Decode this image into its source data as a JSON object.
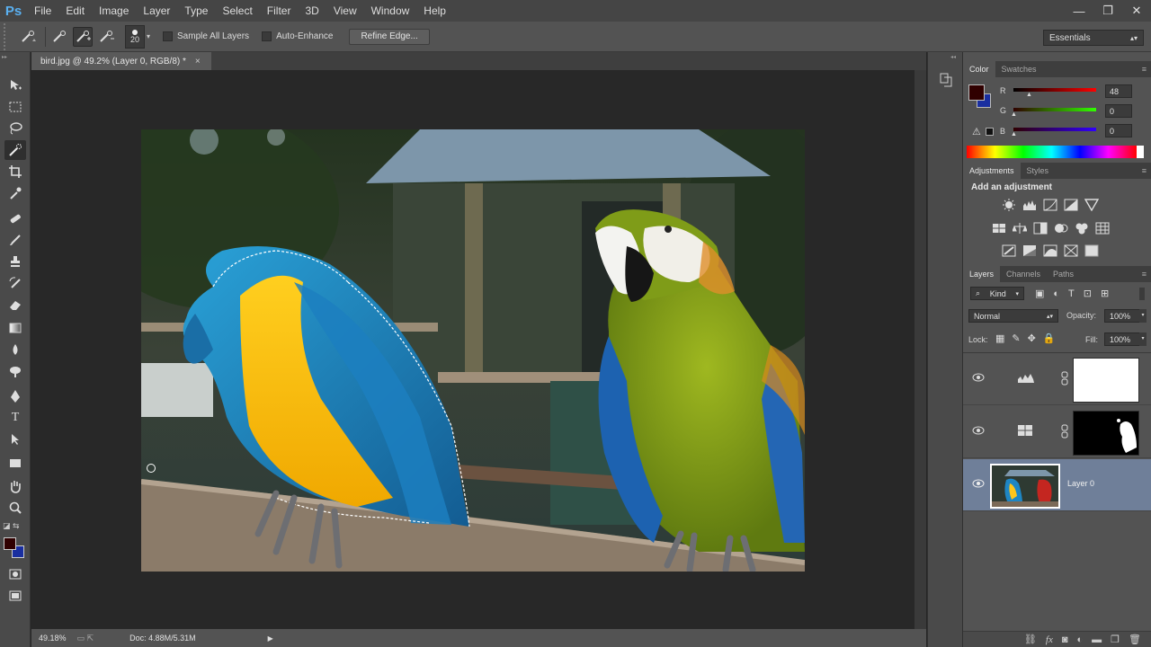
{
  "app": {
    "logo": "Ps"
  },
  "menu": [
    "File",
    "Edit",
    "Image",
    "Layer",
    "Type",
    "Select",
    "Filter",
    "3D",
    "View",
    "Window",
    "Help"
  ],
  "window_controls": [
    "—",
    "❐",
    "✕"
  ],
  "options_bar": {
    "brush_size": "20",
    "sample_all_layers": "Sample All Layers",
    "auto_enhance": "Auto-Enhance",
    "refine_edge": "Refine Edge...",
    "workspace": "Essentials"
  },
  "document": {
    "tab_title": "bird.jpg @ 49.2% (Layer 0, RGB/8) *",
    "tab_close": "×"
  },
  "status": {
    "zoom": "49.18%",
    "doc_size": "Doc: 4.88M/5.31M"
  },
  "color_panel": {
    "tabs": [
      "Color",
      "Swatches"
    ],
    "r_label": "R",
    "g_label": "G",
    "b_label": "B",
    "r": "48",
    "g": "0",
    "b": "0",
    "foreground": "#300000",
    "background": "#1a2fa0"
  },
  "adjustments_panel": {
    "tabs": [
      "Adjustments",
      "Styles"
    ],
    "title": "Add an adjustment"
  },
  "layers_panel": {
    "tabs": [
      "Layers",
      "Channels",
      "Paths"
    ],
    "kind": "Kind",
    "blend_mode": "Normal",
    "opacity_label": "Opacity:",
    "opacity": "100%",
    "lock_label": "Lock:",
    "fill_label": "Fill:",
    "fill": "100%",
    "layers": [
      {
        "name": ""
      },
      {
        "name": ""
      },
      {
        "name": "Layer 0"
      }
    ]
  },
  "colors": {
    "accent": "#5ab0f0",
    "selected_layer": "#6f7f99"
  }
}
